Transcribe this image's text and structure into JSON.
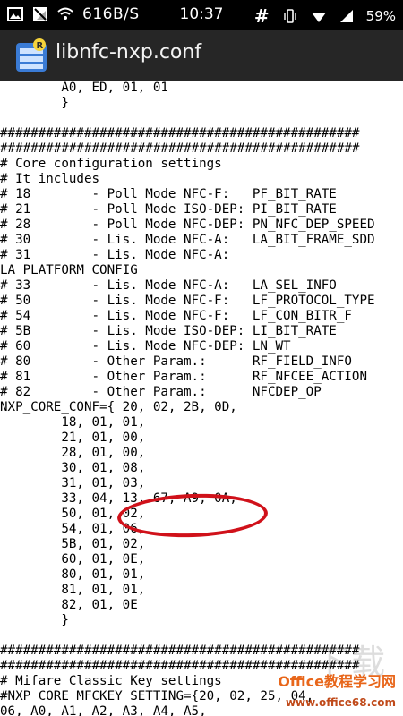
{
  "status_bar": {
    "net_speed": "616B/S",
    "time": "10:37",
    "hash_icon_label": "#",
    "battery": "59%"
  },
  "app_bar": {
    "title": "libnfc-nxp.conf"
  },
  "file_lines": [
    "        A0, ED, 01, 01",
    "        }",
    "",
    "###############################################",
    "###############################################",
    "# Core configuration settings",
    "# It includes",
    "# 18        - Poll Mode NFC-F:   PF_BIT_RATE",
    "# 21        - Poll Mode ISO-DEP: PI_BIT_RATE",
    "# 28        - Poll Mode NFC-DEP: PN_NFC_DEP_SPEED",
    "# 30        - Lis. Mode NFC-A:   LA_BIT_FRAME_SDD",
    "# 31        - Lis. Mode NFC-A:",
    "LA_PLATFORM_CONFIG",
    "# 33        - Lis. Mode NFC-A:   LA_SEL_INFO",
    "# 50        - Lis. Mode NFC-F:   LF_PROTOCOL_TYPE",
    "# 54        - Lis. Mode NFC-F:   LF_CON_BITR_F",
    "# 5B        - Lis. Mode ISO-DEP: LI_BIT_RATE",
    "# 60        - Lis. Mode NFC-DEP: LN_WT",
    "# 80        - Other Param.:      RF_FIELD_INFO",
    "# 81        - Other Param.:      RF_NFCEE_ACTION",
    "# 82        - Other Param.:      NFCDEP_OP",
    "NXP_CORE_CONF={ 20, 02, 2B, 0D,",
    "        18, 01, 01,",
    "        21, 01, 00,",
    "        28, 01, 00,",
    "        30, 01, 08,",
    "        31, 01, 03,",
    "        33, 04, 13, 67, A9, 0A,",
    "        50, 01, 02,",
    "        54, 01, 06,",
    "        5B, 01, 02,",
    "        60, 01, 0E,",
    "        80, 01, 01,",
    "        81, 01, 01,",
    "        82, 01, 0E",
    "        }",
    "",
    "###############################################",
    "###############################################",
    "# Mifare Classic Key settings",
    "#NXP_CORE_MFCKEY_SETTING={20, 02, 25, 04,",
    "06, A0, A1, A2, A3, A4, A5,"
  ],
  "watermark": {
    "brand": "Office教程学习网",
    "url": "www.office68.com"
  }
}
